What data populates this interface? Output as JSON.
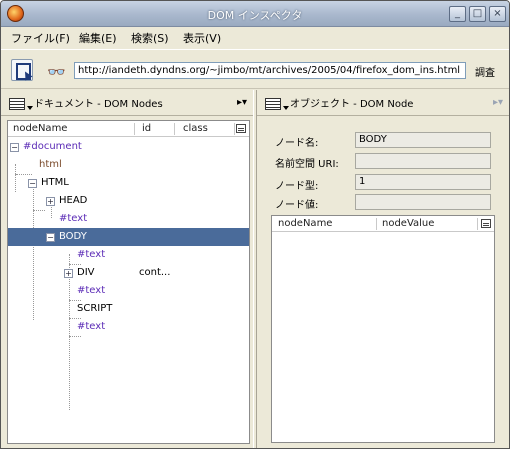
{
  "window": {
    "title": "DOM インスペクタ",
    "minimize": "_",
    "maximize": "□",
    "close": "×"
  },
  "menu": [
    {
      "label": "ファイル(F)"
    },
    {
      "label": "編集(E)"
    },
    {
      "label": "検索(S)"
    },
    {
      "label": "表示(V)"
    }
  ],
  "toolbar": {
    "url": "http://iandeth.dyndns.org/~jimbo/mt/archives/2005/04/firefox_dom_ins.html",
    "go_label": "調査",
    "search_icon": "binoculars-icon",
    "inspect_icon": "inspect-element-icon"
  },
  "left_panel": {
    "title": "ドキュメント - DOM Nodes",
    "menu_glyph": "▸▾",
    "columns": [
      "nodeName",
      "id",
      "class"
    ],
    "rows": [
      {
        "name": "#document",
        "twisty": "−",
        "id": "",
        "class": ""
      },
      {
        "name": "html",
        "twisty": "",
        "id": "",
        "class": ""
      },
      {
        "name": "HTML",
        "twisty": "−",
        "id": "",
        "class": ""
      },
      {
        "name": "HEAD",
        "twisty": "+",
        "id": "",
        "class": ""
      },
      {
        "name": "#text",
        "twisty": "",
        "id": "",
        "class": ""
      },
      {
        "name": "BODY",
        "twisty": "−",
        "id": "",
        "class": ""
      },
      {
        "name": "#text",
        "twisty": "",
        "id": "",
        "class": ""
      },
      {
        "name": "DIV",
        "twisty": "+",
        "id": "cont...",
        "class": ""
      },
      {
        "name": "#text",
        "twisty": "",
        "id": "",
        "class": ""
      },
      {
        "name": "SCRIPT",
        "twisty": "",
        "id": "",
        "class": ""
      },
      {
        "name": "#text",
        "twisty": "",
        "id": "",
        "class": ""
      }
    ]
  },
  "right_panel": {
    "title": "オブジェクト - DOM Node",
    "menu_glyph": "▸▾",
    "fields": [
      {
        "label": "ノード名:",
        "value": "BODY"
      },
      {
        "label": "名前空間 URI:",
        "value": ""
      },
      {
        "label": "ノード型:",
        "value": "1"
      },
      {
        "label": "ノード値:",
        "value": ""
      }
    ],
    "columns": [
      "nodeName",
      "nodeValue"
    ]
  }
}
